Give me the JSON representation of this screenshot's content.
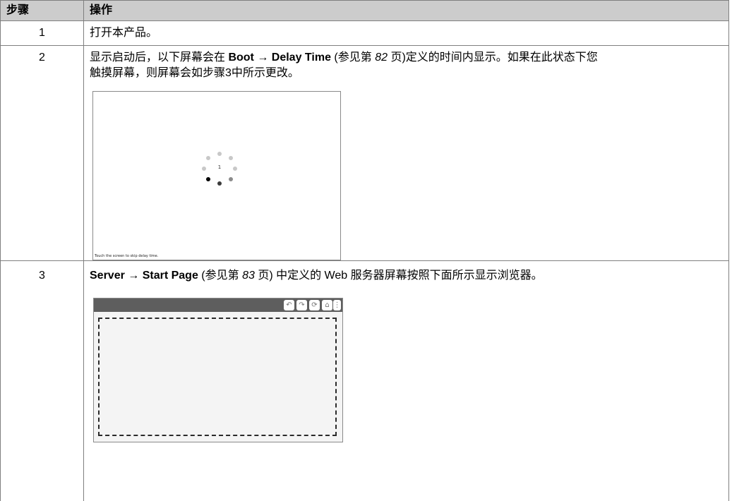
{
  "table": {
    "header": {
      "step": "步骤",
      "action": "操作"
    },
    "rows": [
      {
        "step": "1",
        "text": "打开本产品。"
      },
      {
        "step": "2",
        "text_a": "显示启动后，以下屏幕会在 ",
        "menu_path": "Boot → Delay Time",
        "text_b": " (参见第 ",
        "page": "82",
        "text_c": " 页)定义的时间内显示。如果在此状态下您触摸屏幕，则屏幕会如步骤3中所示更改。",
        "screen": {
          "counter": "1",
          "skip_text": "Touch the screen to skip delay time."
        }
      },
      {
        "step": "3",
        "menu_path": "Server → Start Page",
        "text_b": " (参见第 ",
        "page": "83",
        "text_c": " 页) 中定义的 Web 服务器屏幕按照下面所示显示浏览器。",
        "screen": {
          "toolbar_icons": [
            "back-icon",
            "forward-icon",
            "reload-icon",
            "home-icon",
            "menu-icon"
          ],
          "icon_glyphs": [
            "↶",
            "↷",
            "⟳",
            "⌂",
            "⋮"
          ]
        }
      }
    ]
  },
  "colors": {
    "header_bg": "#cccccc",
    "grid": "#7f7f7f",
    "toolbar": "#5e5e5e",
    "browser_bg": "#f4f4f4"
  }
}
